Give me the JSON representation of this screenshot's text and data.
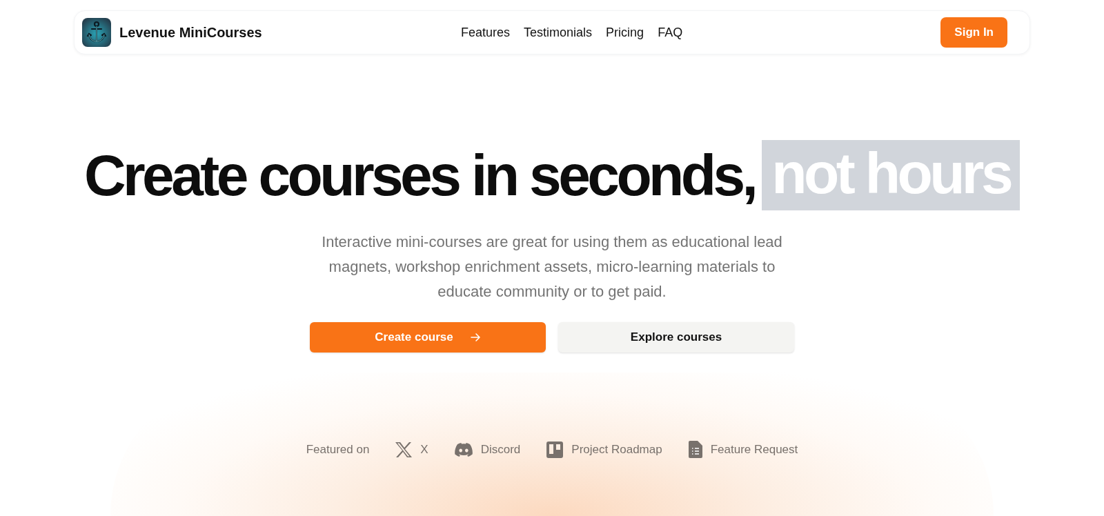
{
  "header": {
    "brand": "Levenue MiniCourses",
    "nav": [
      {
        "label": "Features"
      },
      {
        "label": "Testimonials"
      },
      {
        "label": "Pricing"
      },
      {
        "label": "FAQ"
      }
    ],
    "sign_in": "Sign In"
  },
  "hero": {
    "headline": "Create courses in seconds,",
    "highlight": "not hours",
    "description": "Interactive mini-courses are great for using them as educational lead magnets, workshop enrichment assets, micro-learning materials to educate community or to get paid.",
    "buttons": [
      {
        "label": "Create course",
        "kind": "primary"
      },
      {
        "label": "Explore courses",
        "kind": "secondary"
      }
    ]
  },
  "featured": {
    "label": "Featured on",
    "links": [
      {
        "label": "X",
        "kind": "x"
      },
      {
        "label": "Discord",
        "kind": "discord"
      },
      {
        "label": "Project Roadmap",
        "kind": "board"
      },
      {
        "label": "Feature Request",
        "kind": "document"
      }
    ]
  }
}
